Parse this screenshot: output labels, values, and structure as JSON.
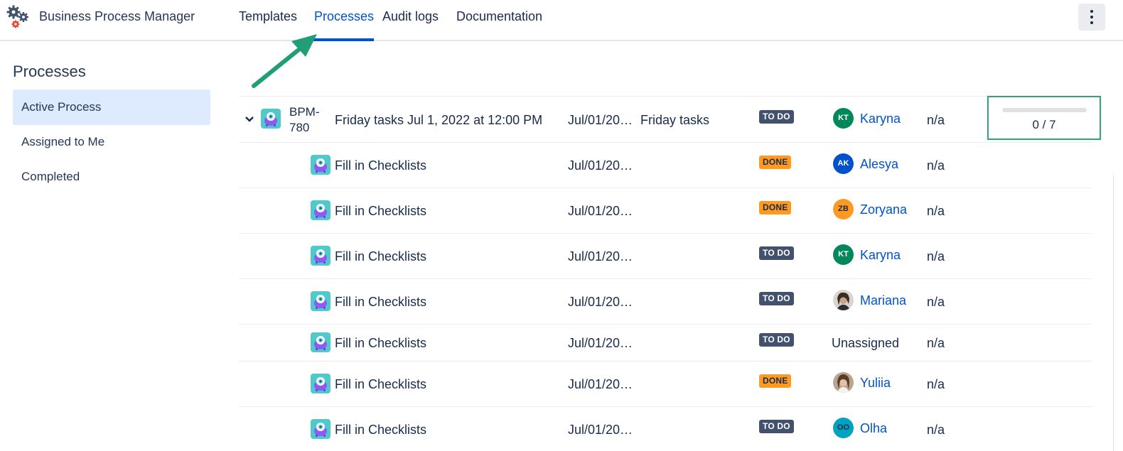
{
  "header": {
    "app_title": "Business Process Manager",
    "nav": [
      {
        "label": "Templates"
      },
      {
        "label": "Processes"
      },
      {
        "label": "Audit logs"
      },
      {
        "label": "Documentation"
      }
    ],
    "active_nav": "Processes",
    "more_icon": "more-vertical-icon"
  },
  "sidebar": {
    "title": "Processes",
    "items": [
      {
        "label": "Active Process",
        "selected": true
      },
      {
        "label": "Assigned to Me",
        "selected": false
      },
      {
        "label": "Completed",
        "selected": false
      }
    ]
  },
  "process": {
    "key_line1": "BPM-",
    "key_line2": "780",
    "summary": "Friday tasks Jul 1, 2022 at 12:00 PM",
    "date": "Jul/01/20…",
    "template": "Friday tasks",
    "status": "TO DO",
    "assignee": "Karyna",
    "assignee_initials": "KT",
    "due": "n/a",
    "progress": {
      "done": 0,
      "total": 7,
      "label": "0 / 7"
    }
  },
  "tasks": [
    {
      "summary": "Fill in Checklists",
      "date": "Jul/01/20…",
      "status": "DONE",
      "assignee": "Alesya",
      "initials": "AK",
      "due": "n/a"
    },
    {
      "summary": "Fill in Checklists",
      "date": "Jul/01/20…",
      "status": "DONE",
      "assignee": "Zoryana",
      "initials": "ZB",
      "due": "n/a"
    },
    {
      "summary": "Fill in Checklists",
      "date": "Jul/01/20…",
      "status": "TO DO",
      "assignee": "Karyna",
      "initials": "KT",
      "due": "n/a"
    },
    {
      "summary": "Fill in Checklists",
      "date": "Jul/01/20…",
      "status": "TO DO",
      "assignee": "Mariana",
      "initials": "",
      "due": "n/a"
    },
    {
      "summary": "Fill in Checklists",
      "date": "Jul/01/20…",
      "status": "TO DO",
      "assignee": "Unassigned",
      "initials": "",
      "due": "n/a"
    },
    {
      "summary": "Fill in Checklists",
      "date": "Jul/01/20…",
      "status": "DONE",
      "assignee": "Yuliia",
      "initials": "",
      "due": "n/a"
    },
    {
      "summary": "Fill in Checklists",
      "date": "Jul/01/20…",
      "status": "TO DO",
      "assignee": "Olha",
      "initials": "OO",
      "due": "n/a"
    }
  ],
  "colors": {
    "accent": "#0052cc",
    "todo": "#42526e",
    "done": "#ff991f",
    "highlight": "#36a27a",
    "avatar_kt": "#00875a",
    "avatar_ak": "#0052cc",
    "avatar_zb": "#ff991f",
    "avatar_oo": "#00a3bf"
  }
}
